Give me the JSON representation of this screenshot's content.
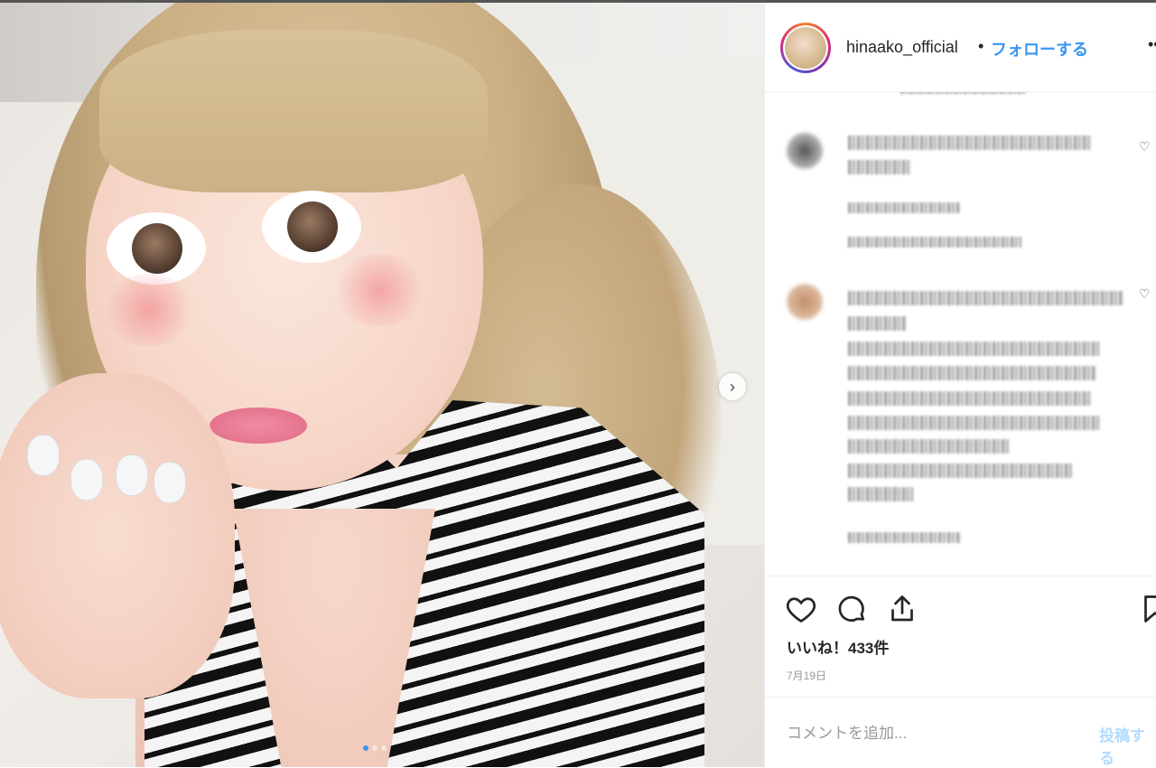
{
  "post": {
    "username": "hinaako_official",
    "separator": "•",
    "follow_label": "フォローする",
    "more_label": "•••",
    "image_alt": "selfie photo",
    "carousel": {
      "slides": 3,
      "active_index": 0
    }
  },
  "comments": [
    {
      "id": "comment-1",
      "avatar": "blurred-avatar",
      "redacted": true
    },
    {
      "id": "comment-2",
      "avatar": "blurred-avatar",
      "redacted": true
    }
  ],
  "actions": {
    "icons": [
      "heart-icon",
      "comment-icon",
      "share-icon",
      "bookmark-icon"
    ],
    "likes_text": "いいね！433件",
    "date_text": "7月19日"
  },
  "comment_box": {
    "placeholder": "コメントを追加...",
    "post_label": "投稿する"
  },
  "colors": {
    "accent": "#3897f0",
    "text": "#262626",
    "muted": "#999999",
    "post_disabled": "#b3dbff",
    "divider": "#efefef"
  }
}
